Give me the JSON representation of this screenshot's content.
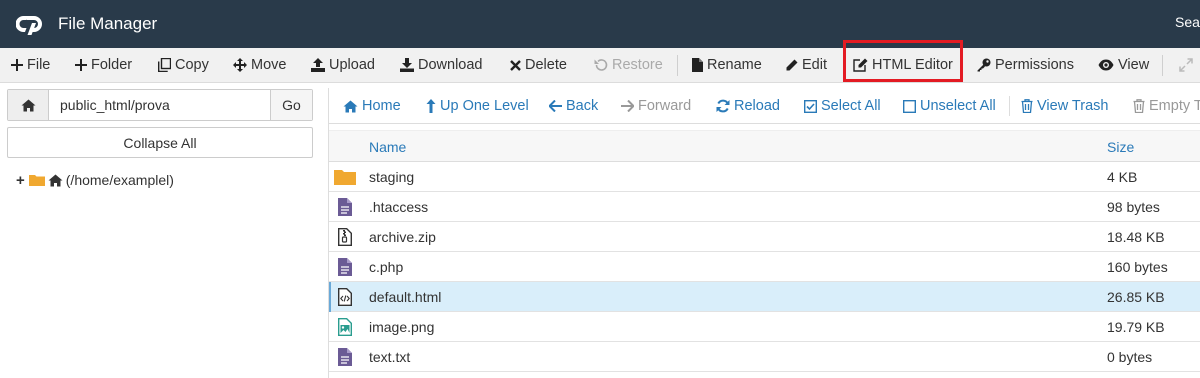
{
  "app": {
    "title": "File Manager",
    "search_label": "Sear"
  },
  "toolbar": {
    "items": [
      {
        "label": "File",
        "icon": "plus-icon"
      },
      {
        "label": "Folder",
        "icon": "plus-icon"
      },
      {
        "label": "Copy",
        "icon": "copy-icon"
      },
      {
        "label": "Move",
        "icon": "move-icon"
      },
      {
        "label": "Upload",
        "icon": "upload-icon"
      },
      {
        "label": "Download",
        "icon": "download-icon"
      },
      {
        "label": "Delete",
        "icon": "close-icon"
      },
      {
        "label": "Restore",
        "icon": "undo-icon",
        "disabled": true
      },
      {
        "label": "Rename",
        "icon": "file-icon"
      },
      {
        "label": "Edit",
        "icon": "pencil-icon"
      },
      {
        "label": "HTML Editor",
        "icon": "edit-square-icon",
        "highlighted": true
      },
      {
        "label": "Permissions",
        "icon": "key-icon"
      },
      {
        "label": "View",
        "icon": "eye-icon"
      },
      {
        "label": "",
        "icon": "expand-icon",
        "disabled": true
      }
    ],
    "highlight_color": "#e31b23"
  },
  "sidebar": {
    "path_value": "public_html/prova",
    "go_label": "Go",
    "collapse_label": "Collapse All",
    "tree_root_label": "(/home/examplel)"
  },
  "navbar": {
    "items": [
      {
        "label": "Home",
        "icon": "home-icon"
      },
      {
        "label": "Up One Level",
        "icon": "level-up-icon"
      },
      {
        "label": "Back",
        "icon": "arrow-left-icon"
      },
      {
        "label": "Forward",
        "icon": "arrow-right-icon",
        "disabled": true
      },
      {
        "label": "Reload",
        "icon": "refresh-icon"
      },
      {
        "label": "Select All",
        "icon": "checkbox-checked-icon"
      },
      {
        "label": "Unselect All",
        "icon": "checkbox-empty-icon"
      },
      {
        "label": "View Trash",
        "icon": "trash-icon"
      },
      {
        "label": "Empty T",
        "icon": "trash-icon",
        "disabled": true
      }
    ]
  },
  "table": {
    "columns": [
      "Name",
      "Size"
    ],
    "rows": [
      {
        "name": "staging",
        "size": "4 KB",
        "type": "folder"
      },
      {
        "name": ".htaccess",
        "size": "98 bytes",
        "type": "text"
      },
      {
        "name": "archive.zip",
        "size": "18.48 KB",
        "type": "zip"
      },
      {
        "name": "c.php",
        "size": "160 bytes",
        "type": "text"
      },
      {
        "name": "default.html",
        "size": "26.85 KB",
        "type": "html",
        "selected": true
      },
      {
        "name": "image.png",
        "size": "19.79 KB",
        "type": "image"
      },
      {
        "name": "text.txt",
        "size": "0 bytes",
        "type": "text"
      }
    ]
  },
  "colors": {
    "header_bg": "#293a4a",
    "link_blue": "#2a7ab8",
    "selected_row": "#d9eefa",
    "folder": "#f0a830",
    "file_purple": "#6b5b95",
    "image_green": "#2a9d8f"
  }
}
